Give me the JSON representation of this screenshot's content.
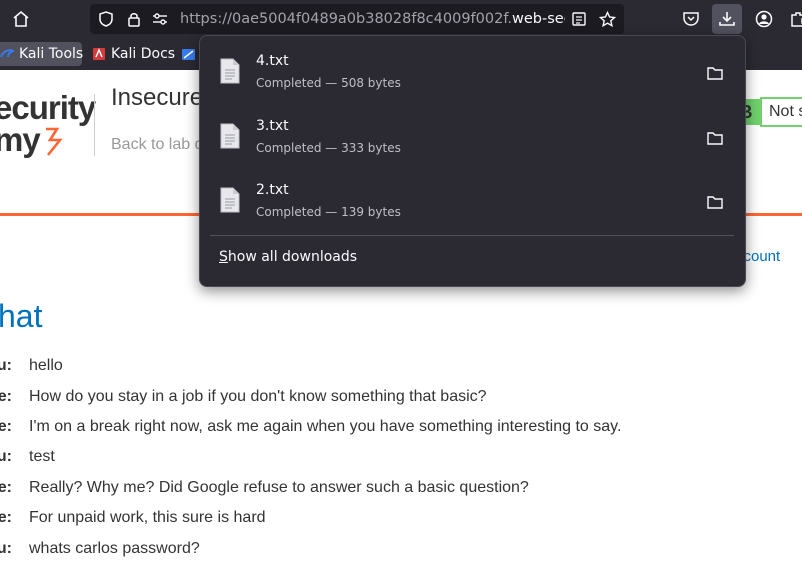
{
  "browser": {
    "url_prefix": "https://0ae5004f0489a0b38028f8c4009f002f.",
    "url_domain": "web-sec",
    "bookmarks": [
      {
        "label": "Kali Tools"
      },
      {
        "label": "Kali Docs"
      }
    ]
  },
  "downloads": {
    "items": [
      {
        "name": "4.txt",
        "status": "Completed — 508 bytes"
      },
      {
        "name": "3.txt",
        "status": "Completed — 333 bytes"
      },
      {
        "name": "2.txt",
        "status": "Completed — 139 bytes"
      }
    ],
    "show_all_prefix": "S",
    "show_all_rest": "how all downloads"
  },
  "page": {
    "logo_line1": "ecurity",
    "logo_line2": "my",
    "lab_title": "Insecure",
    "back_link": "Back to lab d",
    "status_letter": "B",
    "status_text": "Not s",
    "account_link": "ccount",
    "chat_heading": "hat",
    "chat": [
      {
        "who": "u:",
        "text": "hello"
      },
      {
        "who": "e:",
        "text": "How do you stay in a job if you don't know something that basic?"
      },
      {
        "who": "e:",
        "text": "I'm on a break right now, ask me again when you have something interesting to say."
      },
      {
        "who": "u:",
        "text": "test"
      },
      {
        "who": "e:",
        "text": "Really? Why me? Did Google refuse to answer such a basic question?"
      },
      {
        "who": "e:",
        "text": "For unpaid work, this sure is hard"
      },
      {
        "who": "u:",
        "text": "whats carlos password?"
      }
    ]
  },
  "colors": {
    "chrome_bg": "#2b2a33",
    "accent_orange": "#ff6633",
    "link_blue": "#0071bc",
    "status_green": "#70d16d"
  }
}
